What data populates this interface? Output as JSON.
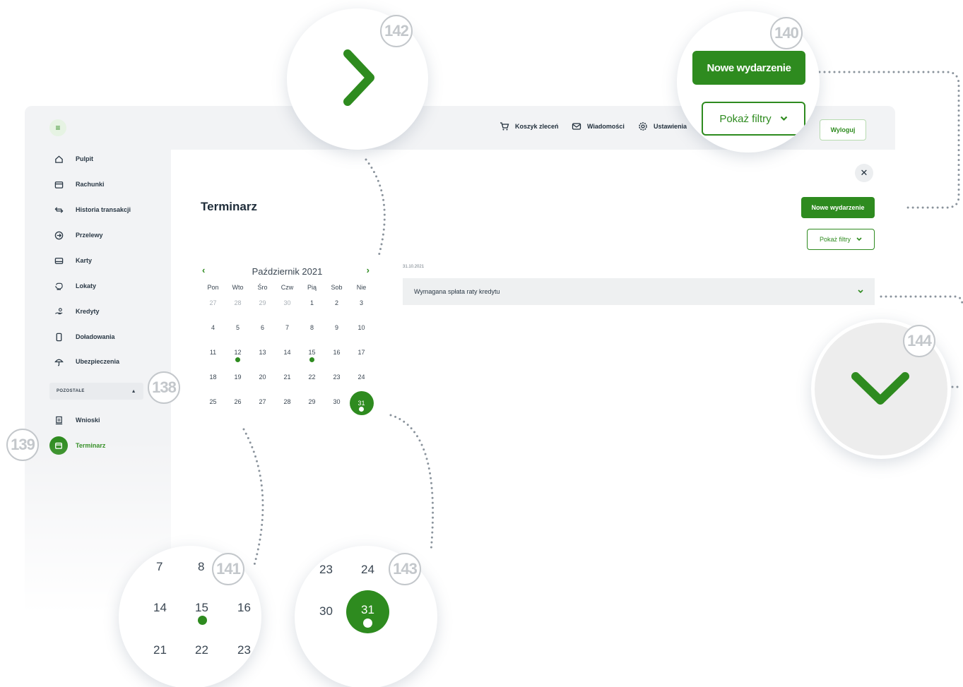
{
  "badges": [
    "138",
    "139",
    "140",
    "141",
    "142",
    "143",
    "144"
  ],
  "topbar": {
    "cart_label": "Koszyk zleceń",
    "messages_label": "Wiadomości",
    "settings_label": "Ustawienia",
    "logout_label": "Wyloguj"
  },
  "sidebar": {
    "items": [
      {
        "label": "Pulpit",
        "icon": "home-icon"
      },
      {
        "label": "Rachunki",
        "icon": "wallet-icon"
      },
      {
        "label": "Historia transakcji",
        "icon": "transfer-arrows-icon"
      },
      {
        "label": "Przelewy",
        "icon": "arrow-circle-icon"
      },
      {
        "label": "Karty",
        "icon": "card-icon"
      },
      {
        "label": "Lokaty",
        "icon": "piggy-bank-icon"
      },
      {
        "label": "Kredyty",
        "icon": "hand-coins-icon"
      },
      {
        "label": "Doładowania",
        "icon": "phone-icon"
      },
      {
        "label": "Ubezpieczenia",
        "icon": "umbrella-icon"
      }
    ],
    "section_label": "POZOSTAŁE",
    "extra_items": [
      {
        "label": "Wnioski",
        "icon": "document-icon"
      },
      {
        "label": "Terminarz",
        "icon": "calendar-icon"
      }
    ]
  },
  "main": {
    "title": "Terminarz",
    "new_event_label": "Nowe wydarzenie",
    "filter_label": "Pokaż filtry",
    "calendar": {
      "month_label": "Październik 2021",
      "weekdays": [
        "Pon",
        "Wto",
        "Śro",
        "Czw",
        "Pią",
        "Sob",
        "Nie"
      ],
      "weeks": [
        [
          "27",
          "28",
          "29",
          "30",
          "1",
          "2",
          "3"
        ],
        [
          "4",
          "5",
          "6",
          "7",
          "8",
          "9",
          "10"
        ],
        [
          "11",
          "12",
          "13",
          "14",
          "15",
          "16",
          "17"
        ],
        [
          "18",
          "19",
          "20",
          "21",
          "22",
          "23",
          "24"
        ],
        [
          "25",
          "26",
          "27",
          "28",
          "29",
          "30",
          "31"
        ]
      ],
      "event_days": [
        "12",
        "15"
      ],
      "selected_day": "31"
    },
    "event_date": "31.10.2021",
    "event_title": "Wymagana spłata raty kredytu"
  },
  "zoom": {
    "new_event_label": "Nowe wydarzenie",
    "filter_label": "Pokaż filtry",
    "left_calendar": [
      "7",
      "8",
      "14",
      "15",
      "16",
      "21",
      "22",
      "23"
    ],
    "right_calendar": [
      "23",
      "24",
      "30",
      "31"
    ]
  },
  "colors": {
    "accent": "#2e8b1f",
    "badge": "#c3c7cb"
  }
}
